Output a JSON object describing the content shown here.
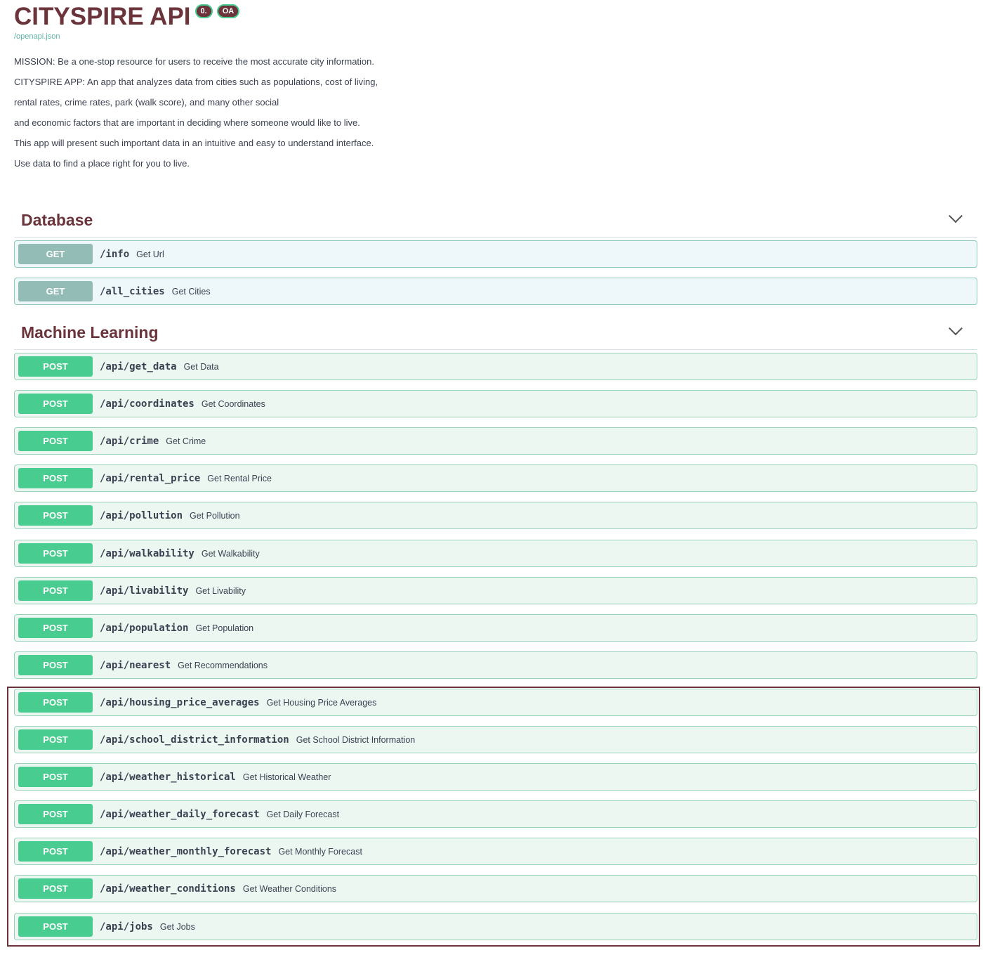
{
  "header": {
    "title": "CITYSPIRE API",
    "badges": [
      "0.",
      "OA"
    ],
    "spec_link": "/openapi.json"
  },
  "description": [
    "MISSION: Be a one-stop resource for users to receive the most accurate city information.",
    "CITYSPIRE APP: An app that analyzes data from cities such as populations, cost of living,",
    "rental rates, crime rates, park (walk score), and many other social",
    "and economic factors that are important in deciding where someone would like to live.",
    "This app will present such important data in an intuitive and easy to understand interface.",
    "Use data to find a place right for you to live."
  ],
  "sections": [
    {
      "name": "Database",
      "ops": [
        {
          "method": "GET",
          "path": "/info",
          "summary": "Get Url"
        },
        {
          "method": "GET",
          "path": "/all_cities",
          "summary": "Get Cities"
        }
      ]
    },
    {
      "name": "Machine Learning",
      "ops": [
        {
          "method": "POST",
          "path": "/api/get_data",
          "summary": "Get Data"
        },
        {
          "method": "POST",
          "path": "/api/coordinates",
          "summary": "Get Coordinates"
        },
        {
          "method": "POST",
          "path": "/api/crime",
          "summary": "Get Crime"
        },
        {
          "method": "POST",
          "path": "/api/rental_price",
          "summary": "Get Rental Price"
        },
        {
          "method": "POST",
          "path": "/api/pollution",
          "summary": "Get Pollution"
        },
        {
          "method": "POST",
          "path": "/api/walkability",
          "summary": "Get Walkability"
        },
        {
          "method": "POST",
          "path": "/api/livability",
          "summary": "Get Livability"
        },
        {
          "method": "POST",
          "path": "/api/population",
          "summary": "Get Population"
        },
        {
          "method": "POST",
          "path": "/api/nearest",
          "summary": "Get Recommendations"
        },
        {
          "method": "POST",
          "path": "/api/housing_price_averages",
          "summary": "Get Housing Price Averages"
        },
        {
          "method": "POST",
          "path": "/api/school_district_information",
          "summary": "Get School District Information"
        },
        {
          "method": "POST",
          "path": "/api/weather_historical",
          "summary": "Get Historical Weather"
        },
        {
          "method": "POST",
          "path": "/api/weather_daily_forecast",
          "summary": "Get Daily Forecast"
        },
        {
          "method": "POST",
          "path": "/api/weather_monthly_forecast",
          "summary": "Get Monthly Forecast"
        },
        {
          "method": "POST",
          "path": "/api/weather_conditions",
          "summary": "Get Weather Conditions"
        },
        {
          "method": "POST",
          "path": "/api/jobs",
          "summary": "Get Jobs"
        }
      ]
    }
  ]
}
